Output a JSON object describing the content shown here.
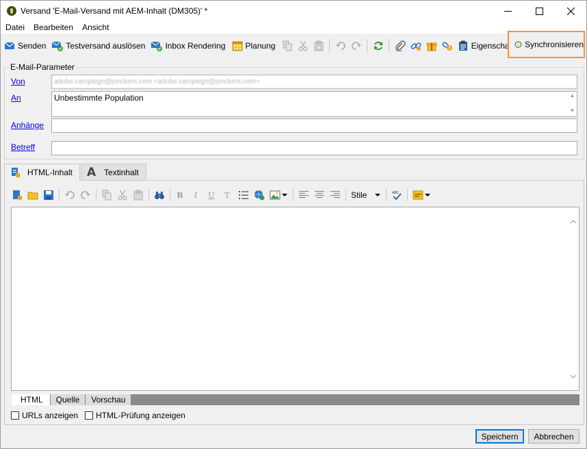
{
  "window": {
    "title": "Versand 'E-Mail-Versand mit AEM-Inhalt (DM305)' *"
  },
  "menu": [
    "Datei",
    "Bearbeiten",
    "Ansicht"
  ],
  "toolbar": {
    "send": "Senden",
    "proof": "Testversand auslösen",
    "inbox_rendering": "Inbox Rendering",
    "schedule": "Planung",
    "properties": "Eigenschaften",
    "synchronize": "Synchronisieren"
  },
  "email_params": {
    "legend": "E-Mail-Parameter",
    "from_label": "Von",
    "from_value": "adobe.campaign@jonckers.com <adobe.campaign@jonckers.com>",
    "to_label": "An",
    "to_value": "Unbestimmte Population",
    "attachments_label": "Anhänge",
    "attachments_value": "",
    "subject_label": "Betreff",
    "subject_value": ""
  },
  "tabs": {
    "html": "HTML-Inhalt",
    "text": "Textinhalt"
  },
  "editor": {
    "styles": "Stile",
    "bold": "B",
    "italic": "I",
    "underline": "U",
    "clear": "T"
  },
  "view_tabs": [
    "HTML",
    "Quelle",
    "Vorschau"
  ],
  "options": {
    "show_urls": "URLs anzeigen",
    "show_html_check": "HTML-Prüfung anzeigen"
  },
  "buttons": {
    "save": "Speichern",
    "cancel": "Abbrechen"
  },
  "colors": {
    "highlight": "#f5923e",
    "link": "#0000ee",
    "primary_border": "#0078d7"
  }
}
